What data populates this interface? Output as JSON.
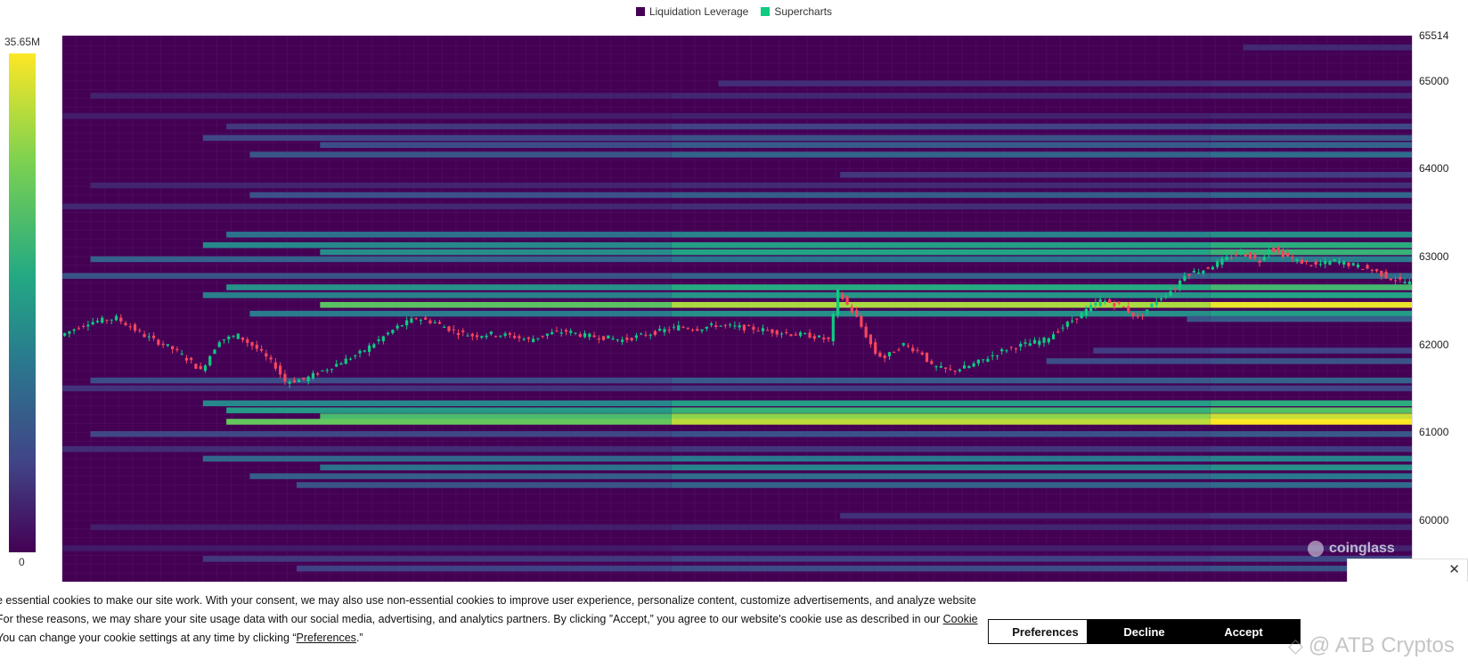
{
  "legend": [
    {
      "label": "Liquidation Leverage",
      "color": "#440154"
    },
    {
      "label": "Supercharts",
      "color": "#0ecb81"
    }
  ],
  "color_scale": {
    "max_label": "35.65M",
    "min_label": "0"
  },
  "watermark": {
    "text": "coinglass"
  },
  "cookie_banner": {
    "line1": "e essential cookies to make our site work. With your consent, we may also use non-essential cookies to improve user experience, personalize content, customize advertisements, and analyze website",
    "line2_before": "For these reasons, we may share your site usage data with our social media, advertising, and analytics partners. By clicking ”Accept,” you agree to our website's cookie use as described in our ",
    "line2_link": "Cookie",
    "line3_before": "You can change your cookie settings at any time by clicking “",
    "line3_link": "Preferences",
    "line3_after": ".”",
    "preferences_label": "Preferences",
    "decline_label": "Decline",
    "accept_label": "Accept",
    "close_glyph": "✕"
  },
  "overlay_mark": {
    "icon": "◇",
    "text": "@ ATB Cryptos"
  },
  "chart_data": {
    "type": "heatmap",
    "title": "",
    "series_names": [
      "Liquidation Leverage",
      "Supercharts"
    ],
    "y_axis": {
      "ticks": [
        65514,
        65000,
        64000,
        63000,
        62000,
        61000,
        60000
      ],
      "range": [
        59300,
        65514
      ],
      "position": "right"
    },
    "colorscale": {
      "min": 0,
      "max": 35650000,
      "max_label": "35.65M",
      "min_label": "0",
      "colors": [
        "#440154",
        "#414487",
        "#2a788e",
        "#22a884",
        "#7ad151",
        "#fde725"
      ]
    },
    "background_color": "#440154",
    "x_steps": 288,
    "liquidation_levels": [
      {
        "price": 65380,
        "start": 252,
        "intensity": 0.12
      },
      {
        "price": 64970,
        "start": 140,
        "intensity": 0.15
      },
      {
        "price": 64830,
        "start": 6,
        "intensity": 0.13
      },
      {
        "price": 64600,
        "start": 0,
        "intensity": 0.11
      },
      {
        "price": 64480,
        "start": 35,
        "intensity": 0.22
      },
      {
        "price": 64350,
        "start": 30,
        "intensity": 0.28
      },
      {
        "price": 64270,
        "start": 55,
        "intensity": 0.32
      },
      {
        "price": 64160,
        "start": 40,
        "intensity": 0.36
      },
      {
        "price": 63930,
        "start": 166,
        "intensity": 0.18
      },
      {
        "price": 63810,
        "start": 6,
        "intensity": 0.14
      },
      {
        "price": 63700,
        "start": 40,
        "intensity": 0.33
      },
      {
        "price": 63570,
        "start": 0,
        "intensity": 0.15
      },
      {
        "price": 63250,
        "start": 35,
        "intensity": 0.5
      },
      {
        "price": 63130,
        "start": 30,
        "intensity": 0.62
      },
      {
        "price": 63050,
        "start": 55,
        "intensity": 0.65
      },
      {
        "price": 62970,
        "start": 6,
        "intensity": 0.42
      },
      {
        "price": 62780,
        "start": 0,
        "intensity": 0.35
      },
      {
        "price": 62650,
        "start": 35,
        "intensity": 0.68
      },
      {
        "price": 62560,
        "start": 30,
        "intensity": 0.58
      },
      {
        "price": 62450,
        "start": 55,
        "intensity": 0.97
      },
      {
        "price": 62350,
        "start": 40,
        "intensity": 0.55
      },
      {
        "price": 62290,
        "start": 240,
        "intensity": 0.3
      },
      {
        "price": 61930,
        "start": 220,
        "intensity": 0.2
      },
      {
        "price": 61810,
        "start": 210,
        "intensity": 0.26
      },
      {
        "price": 61590,
        "start": 6,
        "intensity": 0.32
      },
      {
        "price": 61500,
        "start": 0,
        "intensity": 0.2
      },
      {
        "price": 61330,
        "start": 30,
        "intensity": 0.62
      },
      {
        "price": 61250,
        "start": 35,
        "intensity": 0.72
      },
      {
        "price": 61180,
        "start": 55,
        "intensity": 0.92
      },
      {
        "price": 61120,
        "start": 35,
        "intensity": 1.0
      },
      {
        "price": 60980,
        "start": 6,
        "intensity": 0.28
      },
      {
        "price": 60810,
        "start": 0,
        "intensity": 0.18
      },
      {
        "price": 60700,
        "start": 30,
        "intensity": 0.45
      },
      {
        "price": 60600,
        "start": 55,
        "intensity": 0.5
      },
      {
        "price": 60500,
        "start": 40,
        "intensity": 0.4
      },
      {
        "price": 60400,
        "start": 50,
        "intensity": 0.35
      },
      {
        "price": 60050,
        "start": 166,
        "intensity": 0.16
      },
      {
        "price": 59920,
        "start": 6,
        "intensity": 0.12
      },
      {
        "price": 59680,
        "start": 0,
        "intensity": 0.1
      },
      {
        "price": 59560,
        "start": 30,
        "intensity": 0.22
      },
      {
        "price": 59450,
        "start": 50,
        "intensity": 0.26
      }
    ],
    "price_path": [
      [
        0,
        62100
      ],
      [
        6,
        62250
      ],
      [
        12,
        62300
      ],
      [
        18,
        62100
      ],
      [
        24,
        61950
      ],
      [
        28,
        61800
      ],
      [
        30,
        61700
      ],
      [
        34,
        62050
      ],
      [
        38,
        62100
      ],
      [
        42,
        61950
      ],
      [
        46,
        61750
      ],
      [
        48,
        61580
      ],
      [
        52,
        61600
      ],
      [
        56,
        61700
      ],
      [
        60,
        61800
      ],
      [
        64,
        61900
      ],
      [
        68,
        62050
      ],
      [
        72,
        62200
      ],
      [
        76,
        62300
      ],
      [
        80,
        62250
      ],
      [
        84,
        62150
      ],
      [
        88,
        62100
      ],
      [
        92,
        62120
      ],
      [
        96,
        62100
      ],
      [
        100,
        62050
      ],
      [
        104,
        62120
      ],
      [
        108,
        62150
      ],
      [
        112,
        62100
      ],
      [
        116,
        62080
      ],
      [
        120,
        62050
      ],
      [
        124,
        62100
      ],
      [
        128,
        62150
      ],
      [
        132,
        62200
      ],
      [
        136,
        62180
      ],
      [
        140,
        62220
      ],
      [
        144,
        62200
      ],
      [
        148,
        62180
      ],
      [
        152,
        62150
      ],
      [
        156,
        62120
      ],
      [
        160,
        62100
      ],
      [
        164,
        62050
      ],
      [
        166,
        62600
      ],
      [
        168,
        62450
      ],
      [
        170,
        62300
      ],
      [
        172,
        62100
      ],
      [
        174,
        61900
      ],
      [
        176,
        61850
      ],
      [
        180,
        62000
      ],
      [
        184,
        61900
      ],
      [
        186,
        61750
      ],
      [
        190,
        61700
      ],
      [
        194,
        61750
      ],
      [
        198,
        61850
      ],
      [
        202,
        61950
      ],
      [
        206,
        62000
      ],
      [
        210,
        62050
      ],
      [
        214,
        62200
      ],
      [
        218,
        62350
      ],
      [
        222,
        62500
      ],
      [
        226,
        62450
      ],
      [
        230,
        62300
      ],
      [
        234,
        62500
      ],
      [
        238,
        62650
      ],
      [
        240,
        62800
      ],
      [
        244,
        62850
      ],
      [
        248,
        62950
      ],
      [
        252,
        63050
      ],
      [
        256,
        62950
      ],
      [
        258,
        63100
      ],
      [
        260,
        63050
      ],
      [
        264,
        62950
      ],
      [
        268,
        62900
      ],
      [
        272,
        62950
      ],
      [
        276,
        62900
      ],
      [
        280,
        62850
      ],
      [
        284,
        62750
      ],
      [
        288,
        62700
      ]
    ]
  }
}
